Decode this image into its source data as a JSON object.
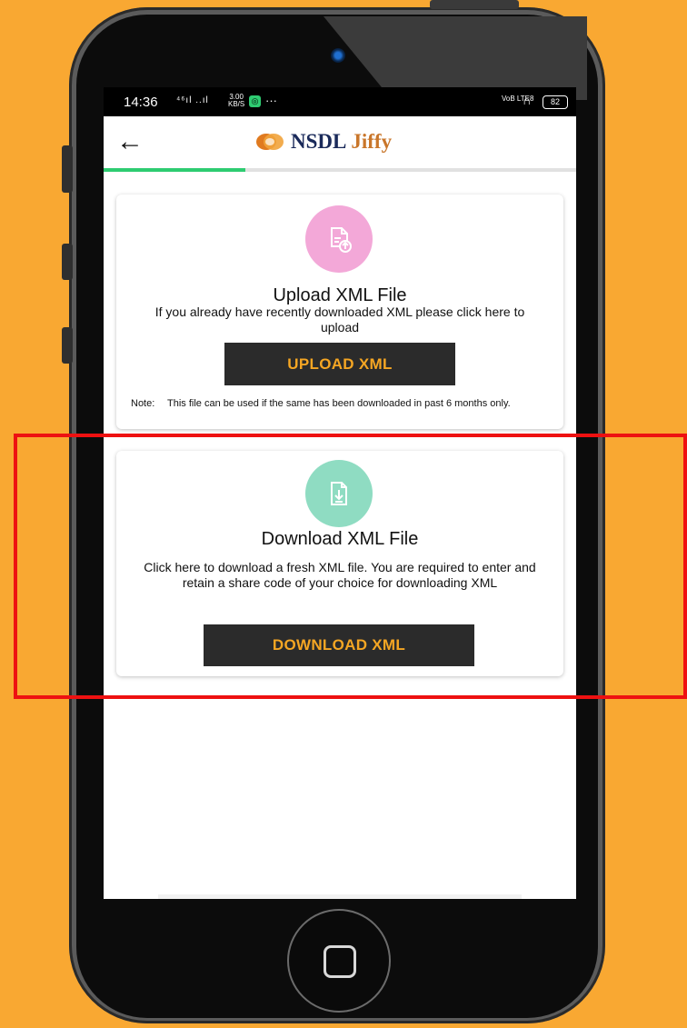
{
  "status_bar": {
    "time": "14:36",
    "signal": "⁴⁶ıl ..ıl",
    "speed_value": "3.00",
    "speed_unit": "KB/S",
    "more": "···",
    "volte": "VoB LTE8",
    "battery": "82"
  },
  "header": {
    "back_icon": "arrow-left-icon",
    "logo_primary": "NSDL",
    "logo_secondary": "Jiffy"
  },
  "progress": {
    "fraction": 0.3
  },
  "upload_card": {
    "icon": "upload-file-icon",
    "title": "Upload XML File",
    "description": "If you already have recently downloaded XML please click here to upload",
    "button_label": "UPLOAD XML",
    "note_label": "Note:",
    "note_text": "This file can be used if the same has been downloaded in past 6 months only."
  },
  "download_card": {
    "icon": "download-file-icon",
    "title": "Download XML File",
    "description": "Click here to download a fresh XML file. You are required to enter and retain a share code of your choice for downloading XML",
    "button_label": "DOWNLOAD XML"
  },
  "colors": {
    "background": "#F9A832",
    "button_text": "#F5A623",
    "progress": "#2ecc71",
    "upload_icon_bg": "#f3a8d8",
    "download_icon_bg": "#8fdcc2",
    "highlight": "#ee1111"
  }
}
